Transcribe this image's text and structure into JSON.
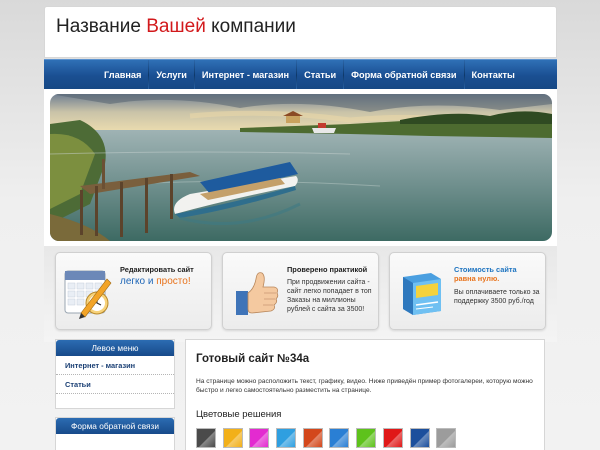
{
  "header": {
    "logo_before": "Название",
    "logo_accent": "Вашей",
    "logo_after": "компании"
  },
  "nav": {
    "items": [
      {
        "label": "Главная"
      },
      {
        "label": "Услуги"
      },
      {
        "label": "Интернет - магазин"
      },
      {
        "label": "Статьи"
      },
      {
        "label": "Форма обратной связи"
      },
      {
        "label": "Контакты"
      }
    ]
  },
  "features": [
    {
      "title": "Редактировать сайт",
      "line2_a": "легко",
      "line2_b": "и",
      "line2_c": "просто!",
      "icon": "calendar-pencil-icon"
    },
    {
      "title": "Проверено практикой",
      "text": "При продвижении сайта - сайт легко попадает в топ Заказы на миллионы рублей с сайта за 3500!",
      "icon": "thumbs-up-icon"
    },
    {
      "title_a": "Стоимость сайта",
      "title_b": "равна  нулю.",
      "text": "Вы оплачиваете только за поддержку 3500 руб./год",
      "icon": "software-box-icon"
    }
  ],
  "sidebar": {
    "menu_title": "Левое меню",
    "menu_items": [
      {
        "label": "Интернет - магазин"
      },
      {
        "label": "Статьи"
      }
    ],
    "form_title": "Форма обратной связи"
  },
  "content": {
    "title": "Готовый сайт №34а",
    "text": "На странице можно расположить текст, графику, видео. Ниже приведён пример фотогалереи, которую можно быстро и легко самостоятельно разместить на странице.",
    "colors_title": "Цветовые решения",
    "swatches": [
      "#4a4a4a",
      "#f2b019",
      "#e32bd0",
      "#2f9fe0",
      "#d3471b",
      "#2a7fd4",
      "#5ec21c",
      "#e01818",
      "#1c4f9c",
      "#9c9c9c"
    ]
  },
  "colors": {
    "nav": "#1a4f92",
    "accent_red": "#d2191c",
    "link_blue": "#1e66b7",
    "orange": "#e8731c"
  }
}
